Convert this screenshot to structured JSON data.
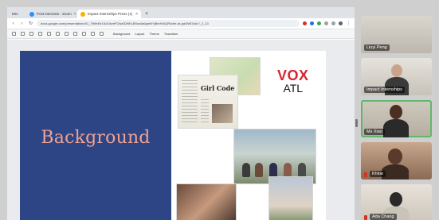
{
  "browser": {
    "tabs": [
      {
        "label": "Mrs",
        "state": "inactive",
        "favicon_color": "#5f6368"
      },
      {
        "label": "Post Interview - Zoom",
        "state": "inactive",
        "favicon_color": "#2d8cff"
      },
      {
        "label": "Impact Internships Press (1)",
        "state": "active",
        "favicon_color": "#f4b400"
      }
    ],
    "new_tab_symbol": "+",
    "close_symbol": "×",
    "url": "docs.google.com/presentation/d/1_7WfeEe1SdOkveFOIw0DWhLB9uc0a6gmNYjBmHUiQRdder-ks.gd/#WO/slc?_2_13",
    "toolbar_items": [
      "Background",
      "Layout",
      "Theme",
      "Transition"
    ]
  },
  "slide": {
    "title": "Background",
    "newspaper_headline": "Girl Code",
    "logo_top": "VOX",
    "logo_bottom": "ATL",
    "colors": {
      "panel": "#2d4585",
      "title": "#f1a190",
      "logo_red": "#d8262e"
    }
  },
  "participants": [
    {
      "name": "Liuyi Peng",
      "active": false
    },
    {
      "name": "Impact Internships",
      "active": false
    },
    {
      "name": "Ms Xiao",
      "active": true
    },
    {
      "name": "Khloe",
      "active": false
    },
    {
      "name": "Ada Chang",
      "active": false
    }
  ]
}
